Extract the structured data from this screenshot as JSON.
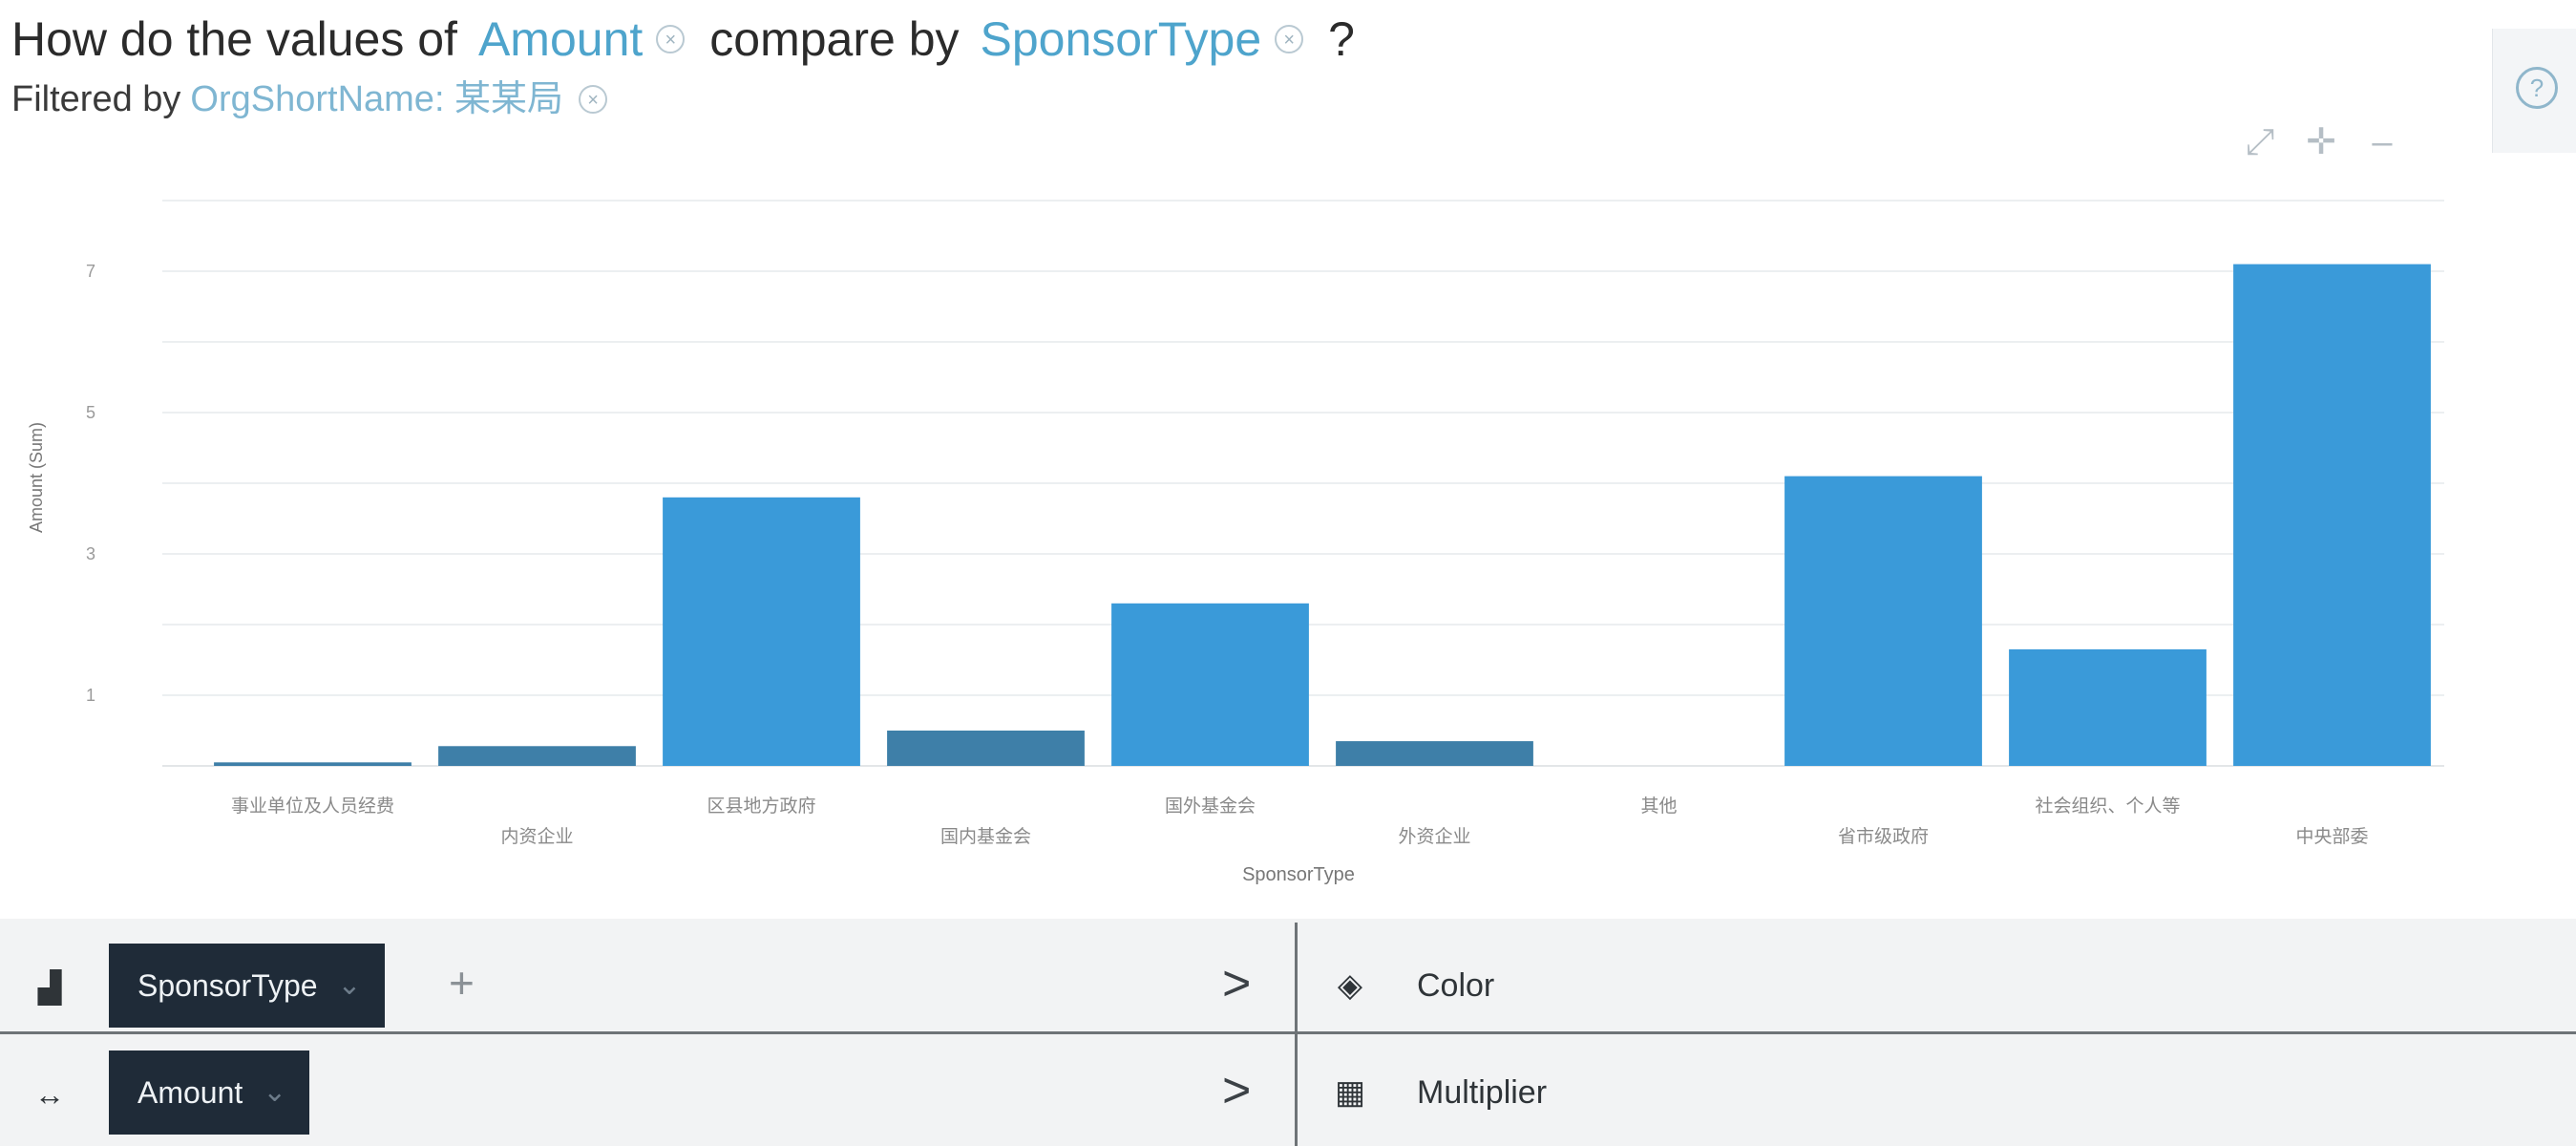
{
  "question": {
    "prefix": "How do the values of",
    "measure": "Amount",
    "middle": "compare by",
    "dimension": "SponsorType",
    "suffix": "?"
  },
  "filter": {
    "prefix": "Filtered by",
    "value": "OrgShortName: 某某局"
  },
  "toolbar": {
    "expand_icon": "expand-icon",
    "crosshair_icon": "crosshair-icon",
    "minimize_icon": "minimize-icon"
  },
  "side_panel": {
    "icon": "assistant-icon"
  },
  "colors": {
    "bar": "#3a9ad9",
    "bar_small": "#3e7fa8",
    "token": "#4ea4cc",
    "pill_bg": "#1f2b38"
  },
  "chart_data": {
    "type": "bar",
    "xlabel": "SponsorType",
    "ylabel": "Amount (Sum)",
    "ylim": [
      0,
      8
    ],
    "yticks": [
      "1",
      "3",
      "5",
      "7"
    ],
    "grid": true,
    "categories": [
      "事业单位及人员经费",
      "内资企业",
      "区县地方政府",
      "国内基金会",
      "国外基金会",
      "外资企业",
      "其他",
      "省市级政府",
      "社会组织、个人等",
      "中央部委"
    ],
    "values": [
      0.05,
      0.28,
      3.8,
      0.5,
      2.3,
      0.35,
      0,
      4.1,
      1.65,
      7.1
    ]
  },
  "bottom": {
    "row1": {
      "icon": "bar-chart-icon",
      "pill": "SponsorType",
      "add": "+",
      "arrow": ">"
    },
    "row2": {
      "icon": "axis-arrows-icon",
      "pill": "Amount",
      "arrow": ">"
    },
    "color": {
      "icon": "paint-bucket-icon",
      "label": "Color"
    },
    "multiplier": {
      "icon": "multiplier-icon",
      "label": "Multiplier"
    }
  }
}
